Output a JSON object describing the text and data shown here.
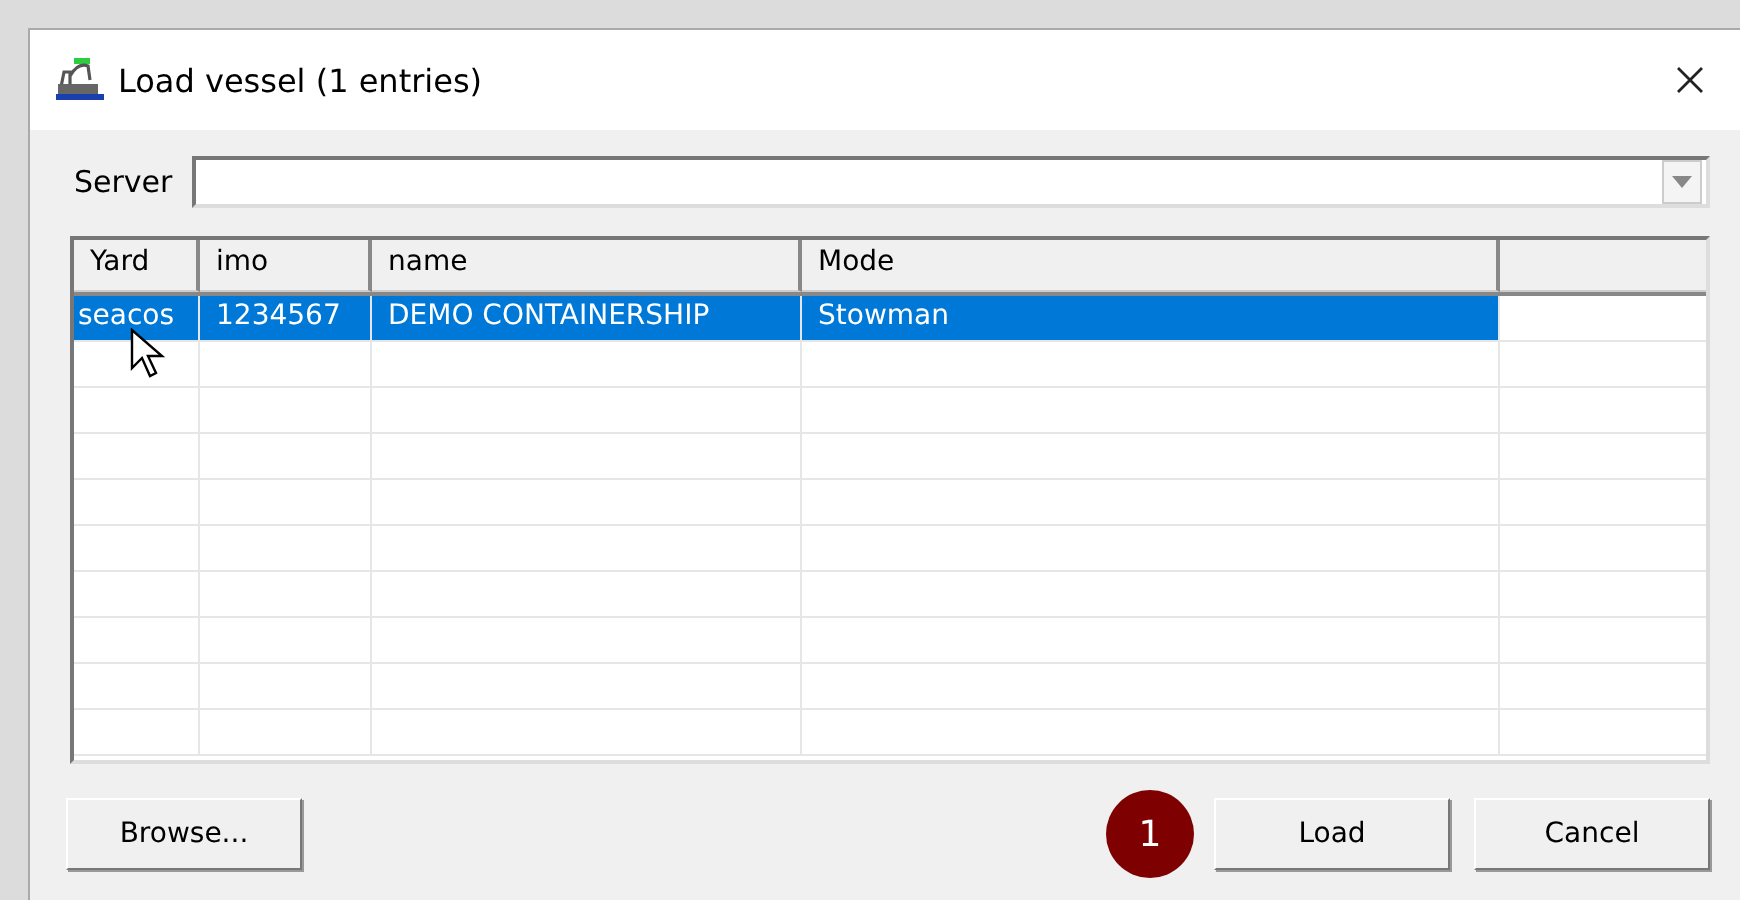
{
  "window": {
    "title": "Load vessel (1 entries)"
  },
  "server": {
    "label": "Server"
  },
  "table": {
    "columns": [
      "Yard",
      "imo",
      "name",
      "Mode"
    ],
    "rows": [
      {
        "cells": [
          "seacos",
          "1234567",
          "DEMO CONTAINERSHIP",
          "Stowman"
        ],
        "selected": true
      }
    ]
  },
  "step_badge": "1",
  "buttons": [
    {
      "label": "Browse...",
      "kind": "left"
    },
    {
      "label": "Load",
      "kind": "right"
    },
    {
      "label": "Cancel",
      "kind": "right"
    }
  ]
}
